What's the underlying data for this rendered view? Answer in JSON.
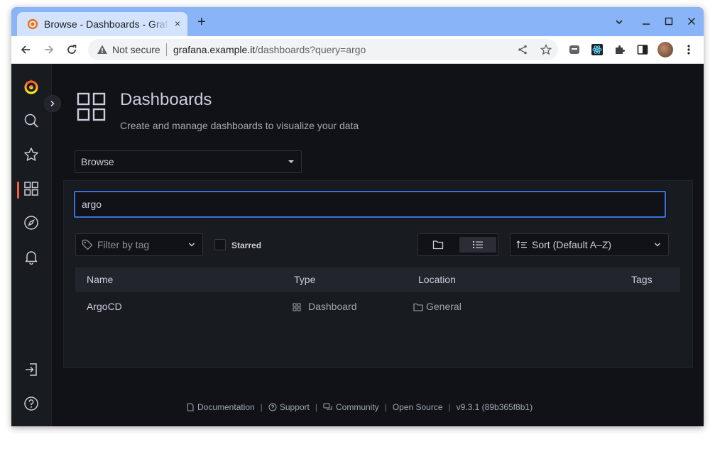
{
  "browser": {
    "tab_title": "Browse - Dashboards - Grafana",
    "tab_close": "×",
    "new_tab": "+",
    "security_label": "Not secure",
    "url_host": "grafana.example.it",
    "url_path": "/dashboards?query=argo"
  },
  "sidebar": {
    "items": [
      {
        "name": "grafana-logo",
        "icon": "grafana-logo"
      },
      {
        "name": "search",
        "icon": "search-icon"
      },
      {
        "name": "starred",
        "icon": "star-icon"
      },
      {
        "name": "dashboards",
        "icon": "apps-icon",
        "active": true
      },
      {
        "name": "explore",
        "icon": "compass-icon"
      },
      {
        "name": "alerting",
        "icon": "bell-icon"
      }
    ],
    "bottom": [
      {
        "name": "sign-in",
        "icon": "sign-in-icon"
      },
      {
        "name": "help",
        "icon": "question-circle-icon"
      }
    ]
  },
  "header": {
    "title": "Dashboards",
    "subtitle": "Create and manage dashboards to visualize your data"
  },
  "browse_select": {
    "value": "Browse"
  },
  "search": {
    "value": "argo"
  },
  "filters": {
    "tag_placeholder": "Filter by tag",
    "starred_label": "Starred",
    "sort_label": "Sort (Default A–Z)",
    "view_mode": "list"
  },
  "table": {
    "columns": [
      "Name",
      "Type",
      "Location",
      "Tags"
    ],
    "rows": [
      {
        "name": "ArgoCD",
        "type": "Dashboard",
        "location": "General",
        "tags": ""
      }
    ]
  },
  "footer": {
    "documentation": "Documentation",
    "support": "Support",
    "community": "Community",
    "open_source": "Open Source",
    "version": "v9.3.1 (89b365f8b1)",
    "separator": "|"
  },
  "colors": {
    "accent": "#f55f3e",
    "focus": "#3d71d9",
    "background": "#111217"
  }
}
